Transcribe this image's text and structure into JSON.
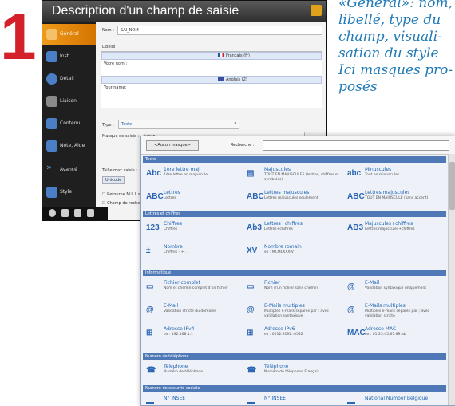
{
  "step_number": "1",
  "caption": [
    "«Général»: nom,",
    "libellé, type du",
    "champ, visuali-",
    "sation du style",
    "Ici masques pro-",
    "posés"
  ],
  "window": {
    "title": "Description d'un champ de saisie",
    "sidebar": [
      "Général",
      "Inst",
      "Détail",
      "Liaison",
      "Contenu",
      "Note, Aide",
      "Avancé",
      "Style"
    ],
    "fields": {
      "nom_label": "Nom :",
      "nom_value": "SAI_NOM",
      "libelle_label": "Libellé :",
      "lang1": "Français (fr)",
      "lang1_text": "Votre nom :",
      "lang2": "Anglais (2)",
      "lang2_text": "Your name:",
      "type_label": "Type :",
      "type_value": "Texte",
      "masque_label": "Masque de saisie :",
      "masque_value": "Aucun",
      "taille_label": "Taille max saisie :",
      "unicode": "Unicode",
      "retourne_null": "Retourne NULL s",
      "champ_recherche": "Champ de recher"
    }
  },
  "popup": {
    "toolbar": {
      "aucun_button": "<Aucun masque>",
      "search_label": "Recherche :",
      "search_value": ""
    },
    "sections": [
      {
        "title": "Texte",
        "items": [
          {
            "icon": "Abc",
            "title": "1ère lettre maj.",
            "desc": "1ère lettre en majuscule"
          },
          {
            "icon": "▤",
            "title": "Majuscules",
            "desc": "TOUT EN MAJUSCULES (lettres, chiffres et symboles)"
          },
          {
            "icon": "abc",
            "title": "Minuscules",
            "desc": "Tout en minuscules"
          },
          {
            "icon": "ABC",
            "title": "Lettres",
            "desc": "Lettres"
          },
          {
            "icon": "ABC",
            "title": "Lettres majuscules",
            "desc": "Lettres majuscules seulement"
          },
          {
            "icon": "ABC",
            "title": "Lettres majuscules",
            "desc": "TOUT EN MAJUSCULE (sans accent)"
          }
        ]
      },
      {
        "title": "Lettres et chiffres",
        "items": [
          {
            "icon": "123",
            "title": "Chiffres",
            "desc": "Chiffres"
          },
          {
            "icon": "Ab3",
            "title": "Lettres+chiffres",
            "desc": "Lettres+chiffres"
          },
          {
            "icon": "AB3",
            "title": "Majuscules+chiffres",
            "desc": "Lettres majuscules+chiffres"
          },
          {
            "icon": "±",
            "title": "Nombre",
            "desc": "Chiffres - + . ,"
          },
          {
            "icon": "XV",
            "title": "Nombre romain",
            "desc": "ex : MCMLXXXIV"
          }
        ]
      },
      {
        "title": "Informatique",
        "items": [
          {
            "icon": "▭",
            "title": "Fichier complet",
            "desc": "Nom et chemin complet d'un fichier"
          },
          {
            "icon": "▭",
            "title": "Fichier",
            "desc": "Nom d'un fichier sans chemin"
          },
          {
            "icon": "@",
            "title": "E-Mail",
            "desc": "Validation syntaxique uniquement"
          },
          {
            "icon": "@",
            "title": "E-Mail",
            "desc": "Validation stricte du domaine"
          },
          {
            "icon": "@",
            "title": "E-Mails multiples",
            "desc": "Multiples e-mails séparés par ; avec validation syntaxique"
          },
          {
            "icon": "@",
            "title": "E-Mails multiples",
            "desc": "Multiples e-mails séparés par ; avec validation stricte"
          },
          {
            "icon": "⊞",
            "title": "Adresse IPv4",
            "desc": "ex : 192.168.1.1"
          },
          {
            "icon": "⊞",
            "title": "Adresse IPv6",
            "desc": "ex : 0012:3192::0532"
          },
          {
            "icon": "MAC",
            "title": "Adresse MAC",
            "desc": "ex : 01:23:45:67:89:ab"
          }
        ]
      },
      {
        "title": "Numéro de téléphone",
        "items": [
          {
            "icon": "☎",
            "title": "Téléphone",
            "desc": "Numéro de téléphone"
          },
          {
            "icon": "☎",
            "title": "Téléphone",
            "desc": "Numéro de téléphone Français"
          }
        ]
      },
      {
        "title": "Numéro de sécurité sociale",
        "items": [
          {
            "icon": "▬",
            "title": "N° INSEE",
            "desc": ""
          },
          {
            "icon": "▬",
            "title": "N° INSEE",
            "desc": ""
          },
          {
            "icon": "▬",
            "title": "National Number Belgique",
            "desc": ""
          }
        ]
      }
    ]
  },
  "colors": {
    "accent_red": "#d4202a",
    "caption_blue": "#1f7ab7",
    "active_orange": "#f09a1a",
    "section_blue": "#4f79b6"
  }
}
